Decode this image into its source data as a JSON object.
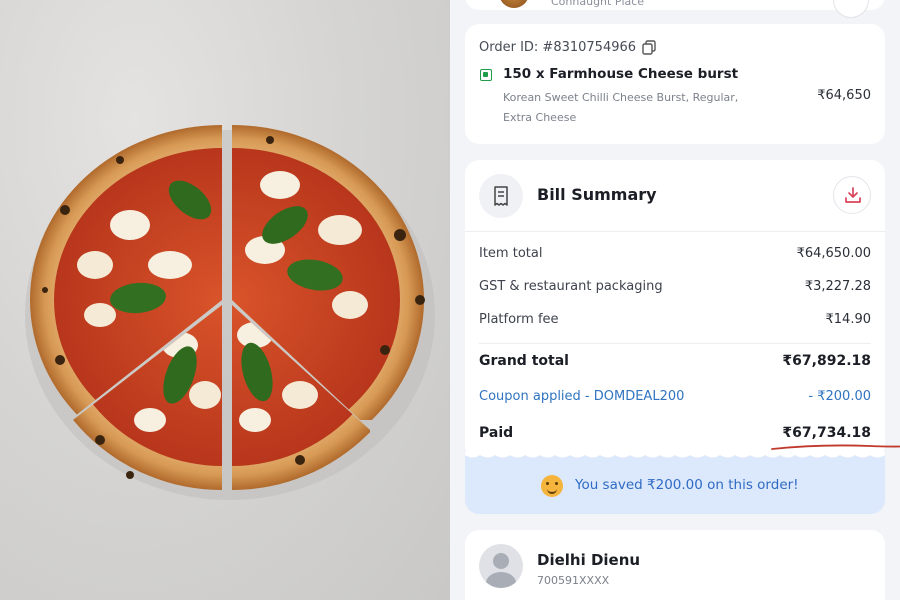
{
  "photo": {
    "subject": "pizza-icon"
  },
  "restaurant": {
    "subtitle": "Connaught Place"
  },
  "order": {
    "id_text": "Order ID: #8310754966",
    "item_name": "150 x Farmhouse Cheese burst",
    "item_desc": "Korean Sweet Chilli Cheese Burst, Regular, Extra Cheese",
    "item_price": "₹64,650"
  },
  "bill": {
    "title": "Bill Summary",
    "rows": [
      {
        "label": "Item total",
        "value": "₹64,650.00"
      },
      {
        "label": "GST & restaurant packaging",
        "value": "₹3,227.28"
      },
      {
        "label": "Platform fee",
        "value": "₹14.90"
      }
    ],
    "grand_total_label": "Grand total",
    "grand_total_value": "₹67,892.18",
    "coupon_label": "Coupon applied - DOMDEAL200",
    "coupon_value": "- ₹200.00",
    "paid_label": "Paid",
    "paid_value": "₹67,734.18"
  },
  "savings": {
    "text": "You saved ₹200.00 on this order!"
  },
  "user": {
    "name": "Dielhi Dienu",
    "phone": "700591XXXX"
  },
  "colors": {
    "accent_blue": "#2f74c0",
    "veg_green": "#1f9c4a",
    "download_red": "#d8455a",
    "underline_red": "#c0392b",
    "banner_bg": "#dce8fb"
  }
}
